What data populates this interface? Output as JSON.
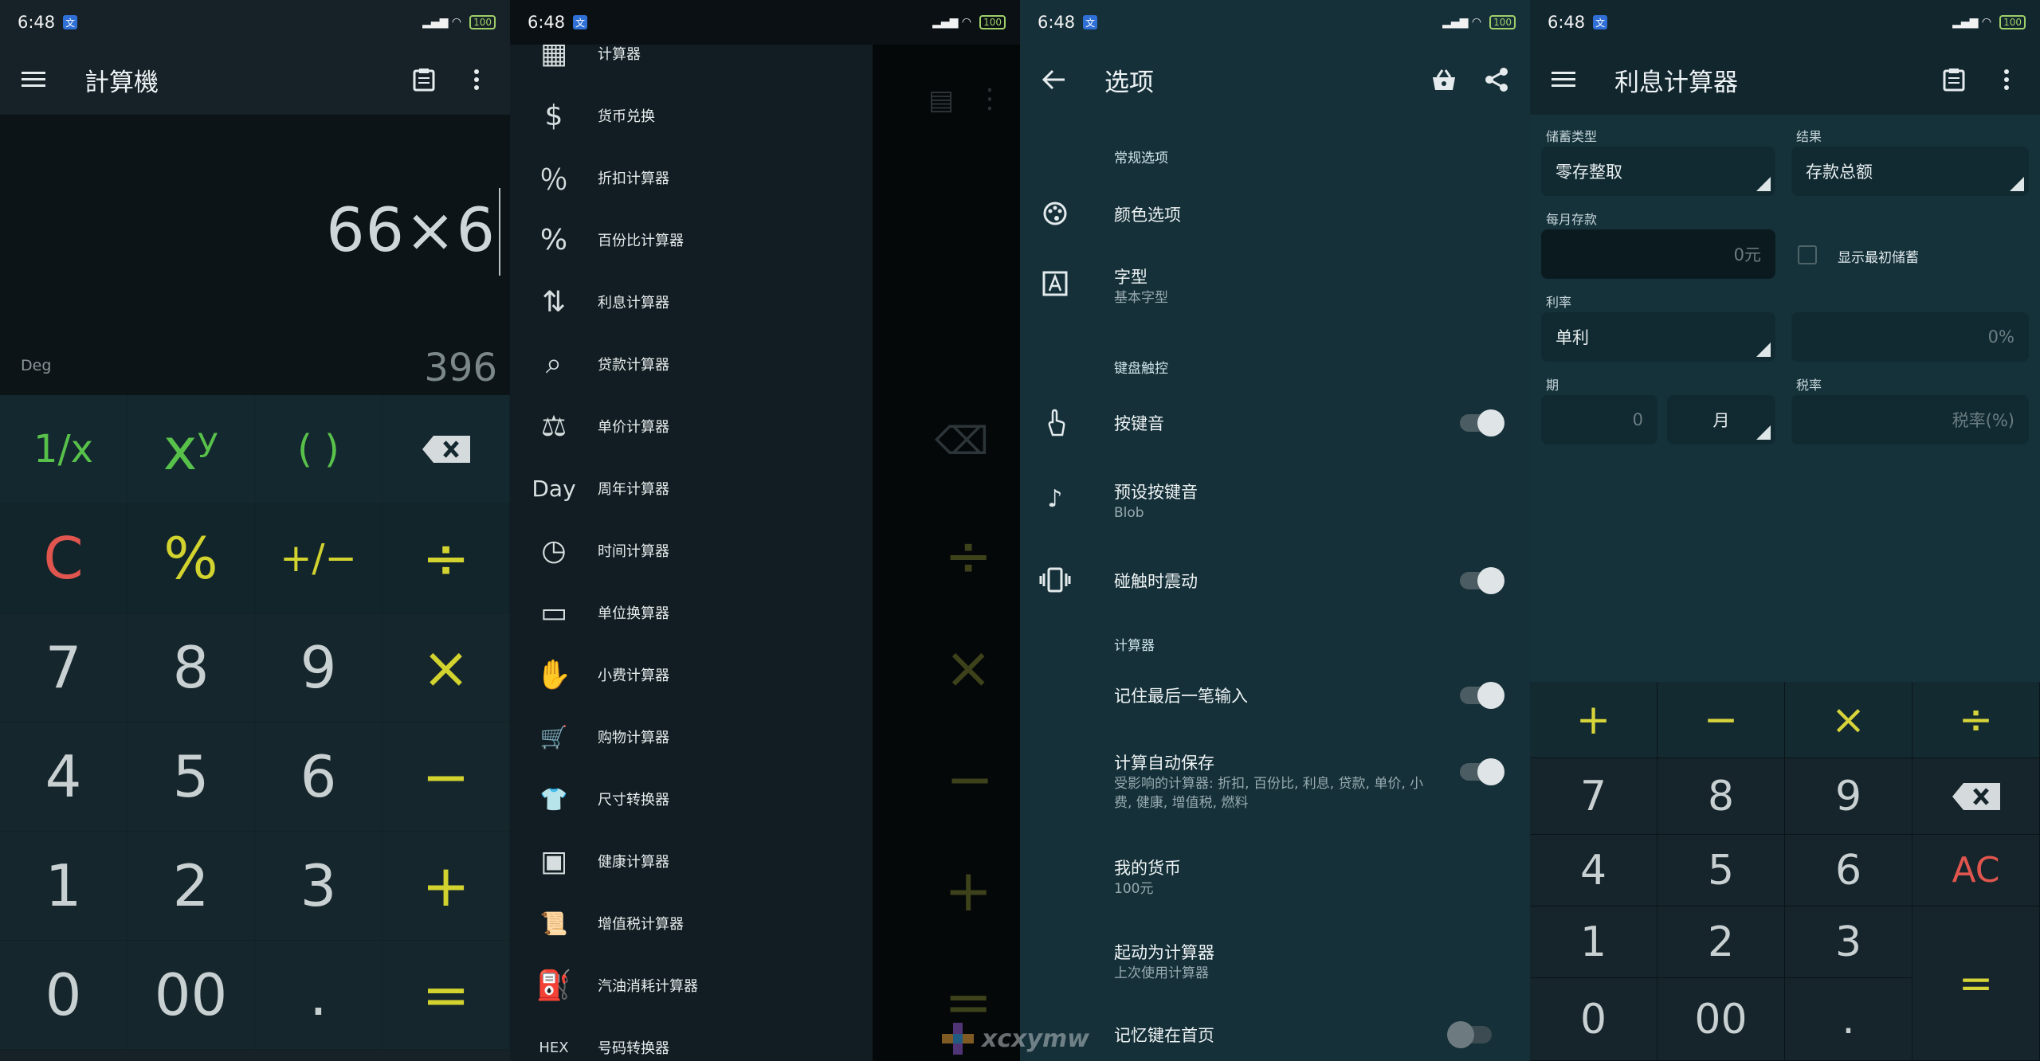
{
  "status": {
    "time": "6:48",
    "badge": "文",
    "signal": "HD",
    "battery": "100"
  },
  "screen1": {
    "title": "計算機",
    "expression": "66×6",
    "mode": "Deg",
    "result": "396",
    "keys": [
      {
        "label": "1/x",
        "type": "fn"
      },
      {
        "label": "xʸ",
        "type": "fn"
      },
      {
        "label": "( )",
        "type": "fn"
      },
      {
        "label": "⌫",
        "type": "back"
      },
      {
        "label": "C",
        "type": "clr"
      },
      {
        "label": "%",
        "type": "op"
      },
      {
        "label": "+/−",
        "type": "op"
      },
      {
        "label": "÷",
        "type": "op"
      },
      {
        "label": "7",
        "type": "num"
      },
      {
        "label": "8",
        "type": "num"
      },
      {
        "label": "9",
        "type": "num"
      },
      {
        "label": "×",
        "type": "op"
      },
      {
        "label": "4",
        "type": "num"
      },
      {
        "label": "5",
        "type": "num"
      },
      {
        "label": "6",
        "type": "num"
      },
      {
        "label": "−",
        "type": "op"
      },
      {
        "label": "1",
        "type": "num"
      },
      {
        "label": "2",
        "type": "num"
      },
      {
        "label": "3",
        "type": "num"
      },
      {
        "label": "+",
        "type": "op"
      },
      {
        "label": "0",
        "type": "num"
      },
      {
        "label": "00",
        "type": "num"
      },
      {
        "label": ".",
        "type": "num"
      },
      {
        "label": "=",
        "type": "op"
      }
    ]
  },
  "screen2": {
    "drawer_items": [
      {
        "label": "计算器",
        "icon": "calculator-icon",
        "glyph": "▦"
      },
      {
        "label": "货币兑换",
        "icon": "dollar-icon",
        "glyph": "$"
      },
      {
        "label": "折扣计算器",
        "icon": "discount-bag-icon",
        "glyph": "％"
      },
      {
        "label": "百份比计算器",
        "icon": "percent-icon",
        "glyph": "%"
      },
      {
        "label": "利息计算器",
        "icon": "interest-icon",
        "glyph": "⇅"
      },
      {
        "label": "贷款计算器",
        "icon": "loan-icon",
        "glyph": "⌕"
      },
      {
        "label": "单价计算器",
        "icon": "scale-icon",
        "glyph": "⚖"
      },
      {
        "label": "周年计算器",
        "icon": "day-icon",
        "glyph": "Day"
      },
      {
        "label": "时间计算器",
        "icon": "clock-icon",
        "glyph": "◷"
      },
      {
        "label": "单位换算器",
        "icon": "ruler-icon",
        "glyph": "▭"
      },
      {
        "label": "小费计算器",
        "icon": "tip-icon",
        "glyph": "✋"
      },
      {
        "label": "购物计算器",
        "icon": "cart-icon",
        "glyph": "🛒"
      },
      {
        "label": "尺寸转换器",
        "icon": "shirt-icon",
        "glyph": "👕"
      },
      {
        "label": "健康计算器",
        "icon": "bathroom-scale-icon",
        "glyph": "▣"
      },
      {
        "label": "增值税计算器",
        "icon": "vat-icon",
        "glyph": "📜"
      },
      {
        "label": "汽油消耗计算器",
        "icon": "fuel-icon",
        "glyph": "⛽"
      },
      {
        "label": "号码转换器",
        "icon": "hex-icon",
        "glyph": "HEX"
      }
    ]
  },
  "screen3": {
    "title": "选项",
    "sections": {
      "general": "常规选项",
      "keyboard": "键盘触控",
      "calculator": "计算器"
    },
    "rows": {
      "color": {
        "title": "颜色选项"
      },
      "font": {
        "title": "字型",
        "sub": "基本字型"
      },
      "keysound": {
        "title": "按键音"
      },
      "default_sound": {
        "title": "预设按键音",
        "sub": "Blob"
      },
      "vibrate": {
        "title": "碰触时震动"
      },
      "remember": {
        "title": "记住最后一笔输入"
      },
      "autosave": {
        "title": "计算自动保存",
        "sub": "受影响的计算器: 折扣, 百份比, 利息, 贷款, 单价, 小费, 健康, 增值税, 燃料"
      },
      "currency": {
        "title": "我的货币",
        "sub": "100元"
      },
      "startup": {
        "title": "起动为计算器",
        "sub": "上次使用计算器"
      },
      "memory": {
        "title": "记忆键在首页"
      }
    }
  },
  "screen4": {
    "title": "利息计算器",
    "labels": {
      "deposit_type": "储蓄类型",
      "result": "结果",
      "monthly": "每月存款",
      "rate": "利率",
      "period": "期",
      "tax": "税率"
    },
    "values": {
      "deposit_type": "零存整取",
      "result": "存款总额",
      "monthly_placeholder": "0元",
      "show_initial": "显示最初储蓄",
      "rate_type": "单利",
      "rate_placeholder": "0%",
      "period_placeholder": "0",
      "period_unit": "月",
      "tax_placeholder": "税率(%)"
    },
    "keys": {
      "plus": "+",
      "minus": "−",
      "times": "×",
      "divide": "÷",
      "n7": "7",
      "n8": "8",
      "n9": "9",
      "back": "⌫",
      "n4": "4",
      "n5": "5",
      "n6": "6",
      "ac": "AC",
      "n1": "1",
      "n2": "2",
      "n3": "3",
      "eq": "=",
      "n0": "0",
      "n00": "00",
      "dot": "."
    }
  },
  "watermark": {
    "text": "xcxymw"
  }
}
